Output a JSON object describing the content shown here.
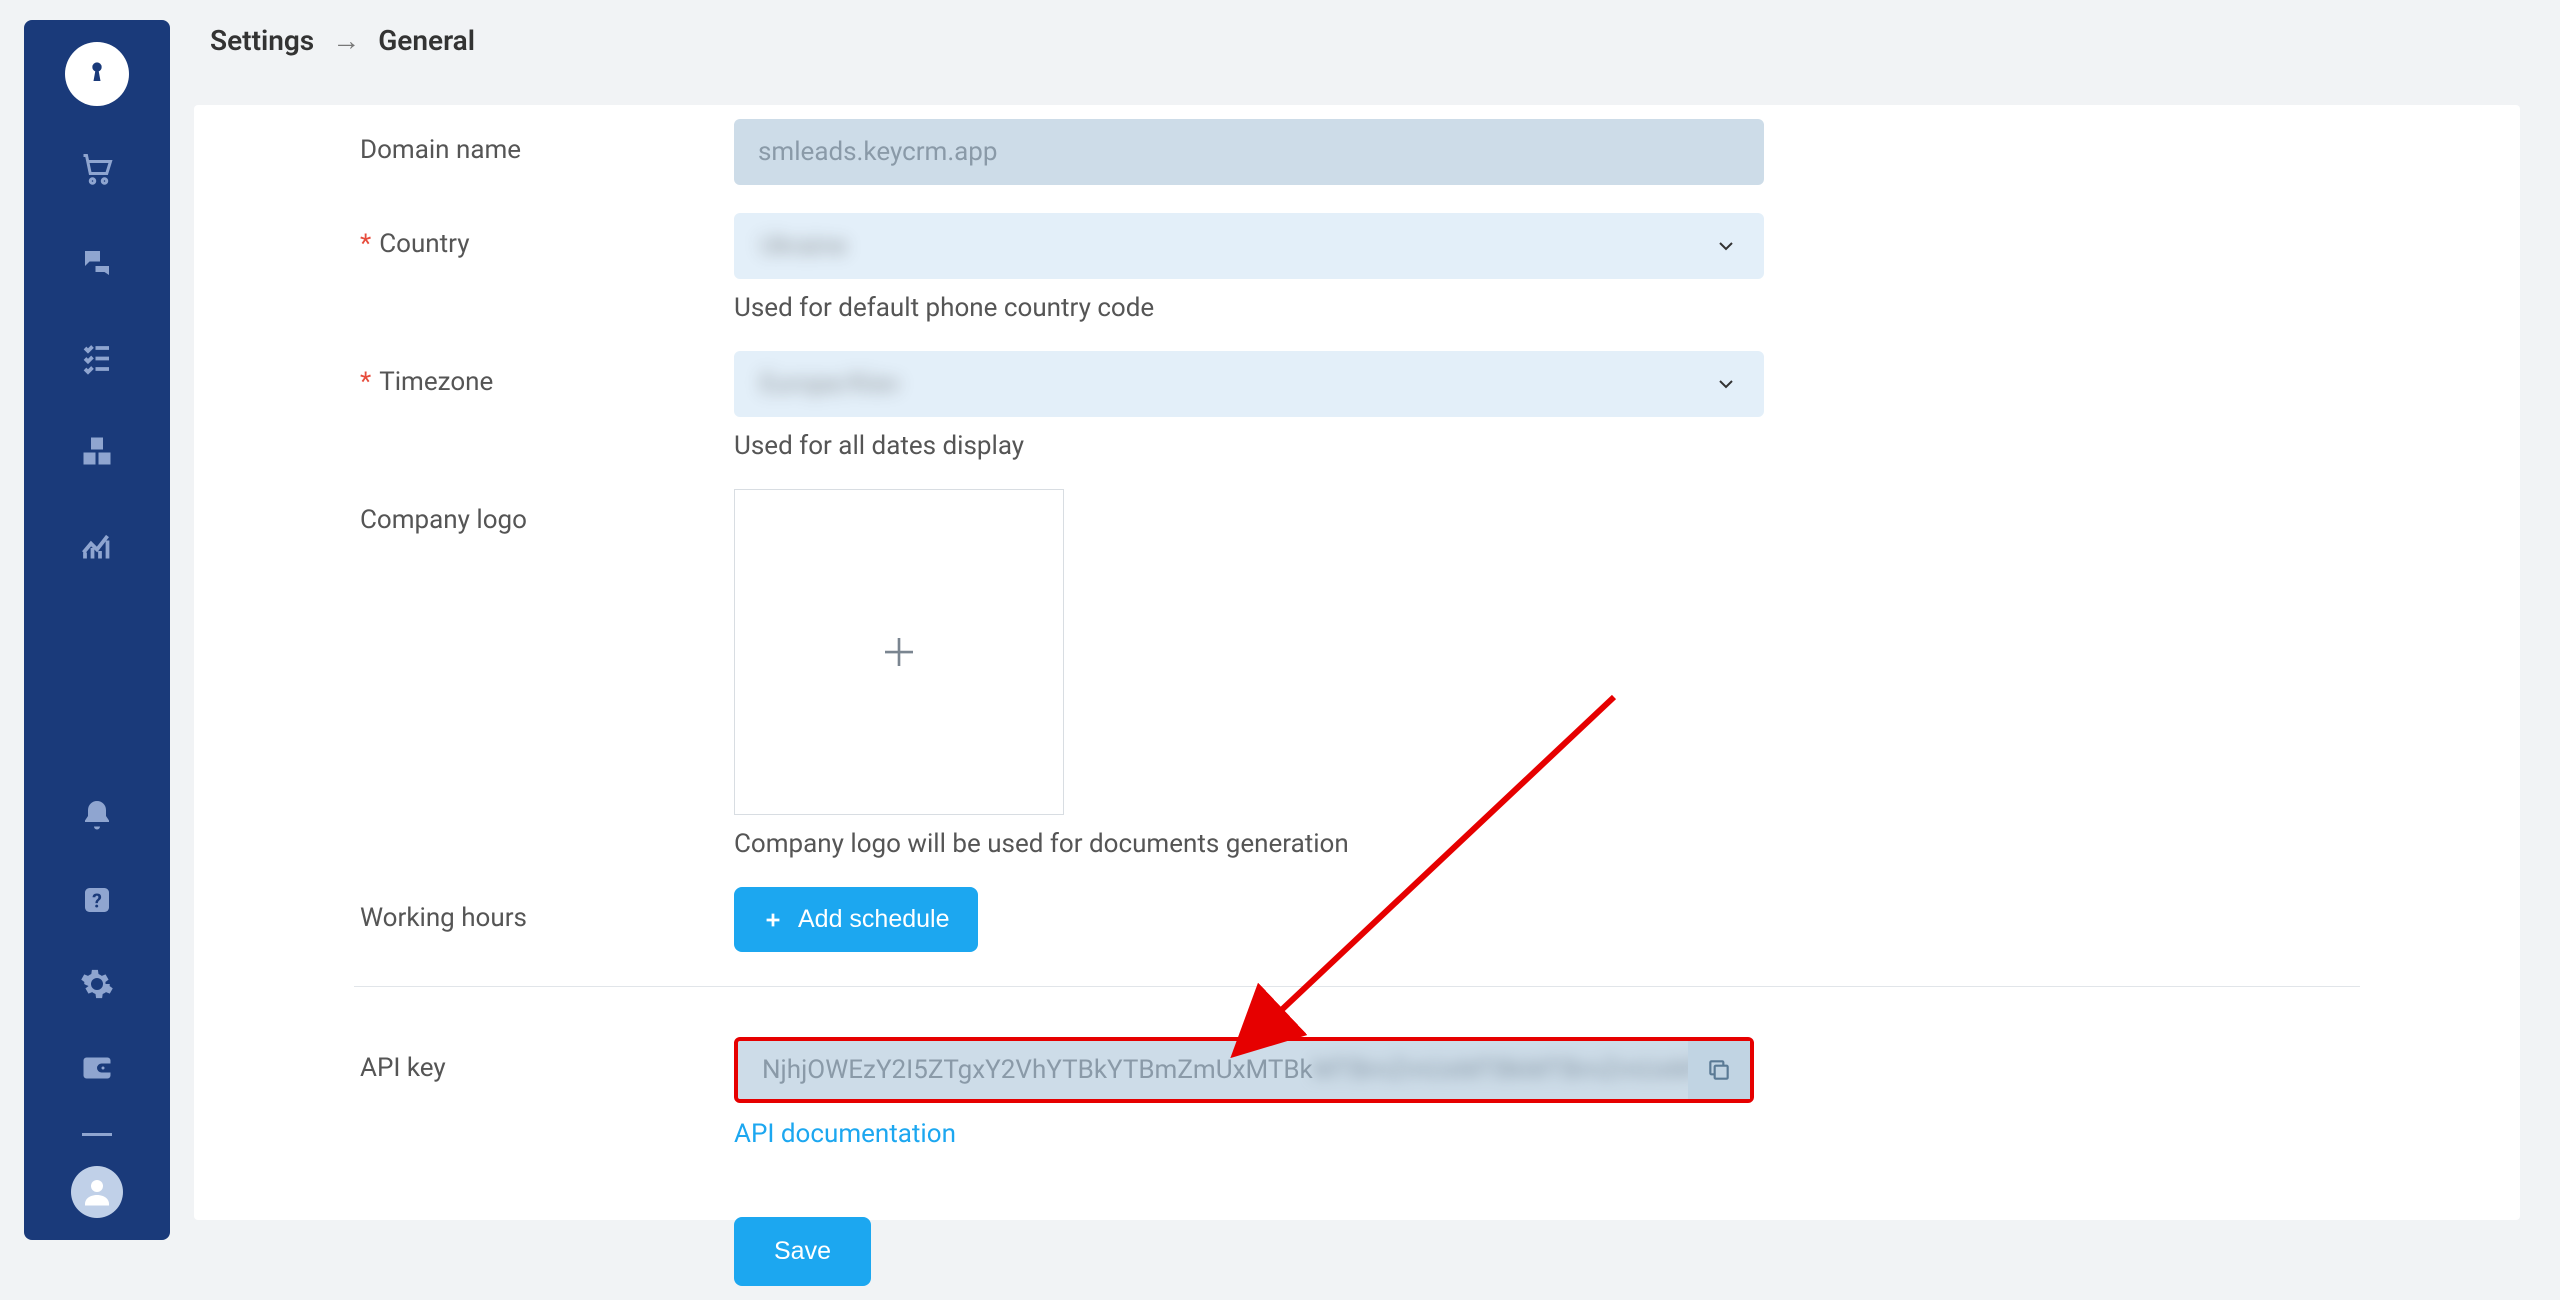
{
  "topbar": {
    "section": "Settings",
    "subsection": "General"
  },
  "form": {
    "domain_label": "Domain name",
    "domain_value": "smleads.keycrm.app",
    "country_label": "Country",
    "country_value": "Ukraine",
    "country_help": "Used for default phone country code",
    "timezone_label": "Timezone",
    "timezone_value": "Europe/Kiev",
    "timezone_help": "Used for all dates display",
    "logo_label": "Company logo",
    "logo_help": "Company logo will be used for documents generation",
    "hours_label": "Working hours",
    "add_schedule_btn": "Add schedule",
    "api_label": "API key",
    "api_value_visible": "NjhjOWEzY2I5ZTgxY2VhYTBkYTBmZmUxMTBk",
    "api_value_blurred": "MTBmZmUxMTBkMTBmZmUxMT",
    "api_doc_link": "API documentation",
    "save_btn": "Save"
  }
}
